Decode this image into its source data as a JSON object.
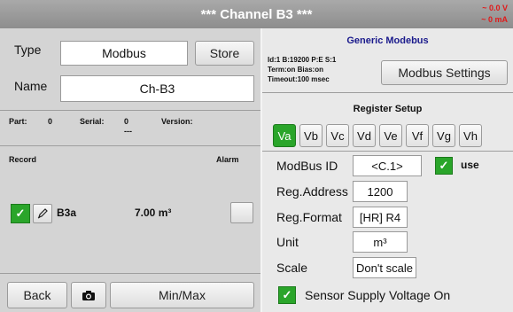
{
  "header": {
    "title": "***  Channel B3  ***",
    "voltage": "~ 0.0 V",
    "current": "~ 0 mA"
  },
  "left": {
    "type_label": "Type",
    "type_value": "Modbus",
    "store_button": "Store",
    "name_label": "Name",
    "name_value": "Ch-B3",
    "part_label": "Part:",
    "part_value": "0",
    "serial_label": "Serial:",
    "serial_value": "0",
    "serial_sub": "---",
    "version_label": "Version:",
    "record_label": "Record",
    "alarm_label": "Alarm",
    "record_name": "B3a",
    "record_value": "7.00 m³",
    "check_mark": "✓",
    "back_button": "Back",
    "minmax_button": "Min/Max",
    "icons": {
      "edit": "pencil-icon",
      "camera": "camera-icon",
      "check": "check-icon"
    }
  },
  "right": {
    "title": "Generic Modebus",
    "info_lines": [
      "Id:1 B:19200 P:E S:1",
      "Term:on Bias:on",
      "Timeout:100 msec"
    ],
    "settings_button": "Modbus Settings",
    "register_title": "Register Setup",
    "tabs": [
      "Va",
      "Vb",
      "Vc",
      "Vd",
      "Ve",
      "Vf",
      "Vg",
      "Vh"
    ],
    "active_tab": "Va",
    "fields": {
      "modbus_id_label": "ModBus ID",
      "modbus_id_value": "<C.1>",
      "use_label": "use",
      "reg_address_label": "Reg.Address",
      "reg_address_value": "1200",
      "reg_format_label": "Reg.Format",
      "reg_format_value": "[HR] R4",
      "unit_label": "Unit",
      "unit_value": "m³",
      "scale_label": "Scale",
      "scale_value": "Don't scale"
    },
    "sensor_supply_label": "Sensor Supply Voltage On"
  },
  "colors": {
    "accent_green": "#2aa52a",
    "title_blue": "#1a1a8c",
    "alert_red": "#e01a1a"
  }
}
